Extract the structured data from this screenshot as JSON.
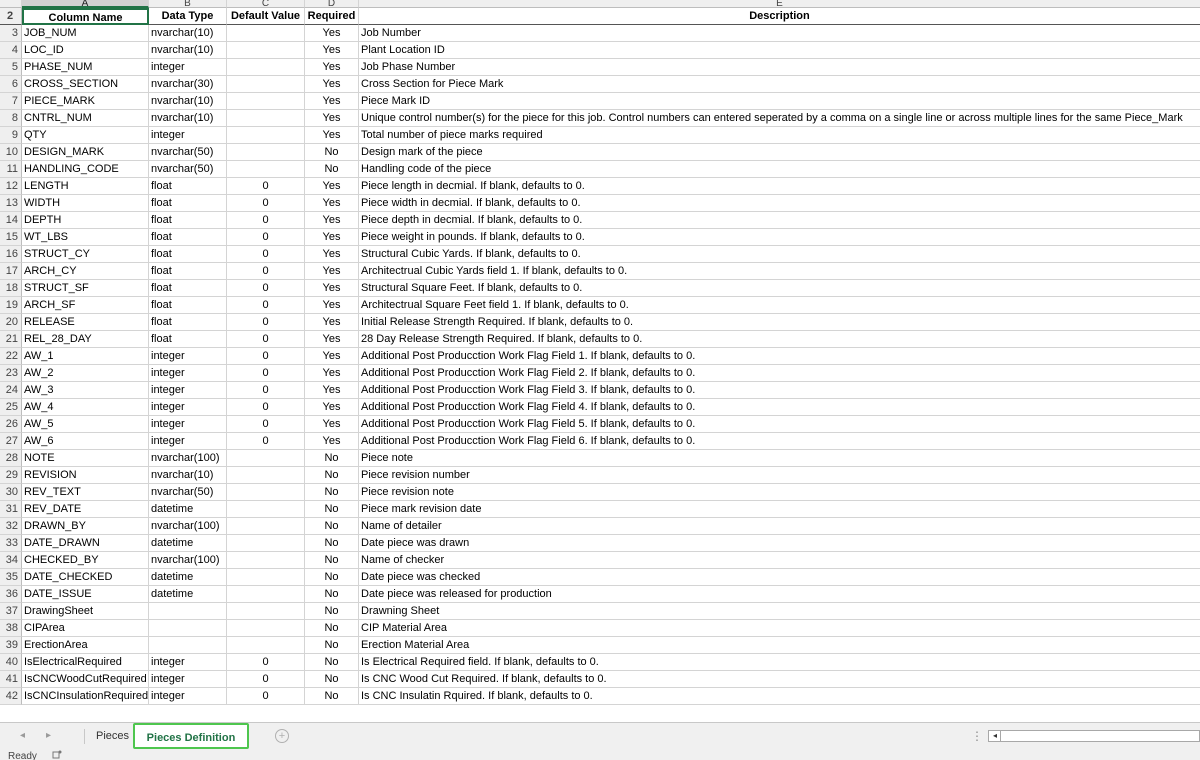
{
  "sheet": {
    "column_letters": [
      "A",
      "B",
      "C",
      "D",
      "E"
    ],
    "header_row": {
      "row_num": "2",
      "cells": [
        "Column Name",
        "Data Type",
        "Default Value",
        "Required",
        "Description"
      ]
    },
    "rows": [
      {
        "n": "3",
        "a": "JOB_NUM",
        "b": "nvarchar(10)",
        "c": "",
        "d": "Yes",
        "e": "Job Number"
      },
      {
        "n": "4",
        "a": "LOC_ID",
        "b": "nvarchar(10)",
        "c": "",
        "d": "Yes",
        "e": "Plant Location ID"
      },
      {
        "n": "5",
        "a": "PHASE_NUM",
        "b": "integer",
        "c": "",
        "d": "Yes",
        "e": "Job Phase Number"
      },
      {
        "n": "6",
        "a": "CROSS_SECTION",
        "b": "nvarchar(30)",
        "c": "",
        "d": "Yes",
        "e": "Cross Section for Piece Mark"
      },
      {
        "n": "7",
        "a": "PIECE_MARK",
        "b": "nvarchar(10)",
        "c": "",
        "d": "Yes",
        "e": "Piece Mark ID"
      },
      {
        "n": "8",
        "a": "CNTRL_NUM",
        "b": "nvarchar(10)",
        "c": "",
        "d": "Yes",
        "e": "Unique control number(s) for the piece for this job.  Control numbers can entered seperated by a comma on a single line or across multiple lines for the same Piece_Mark"
      },
      {
        "n": "9",
        "a": "QTY",
        "b": "integer",
        "c": "",
        "d": "Yes",
        "e": "Total number of piece marks required"
      },
      {
        "n": "10",
        "a": "DESIGN_MARK",
        "b": "nvarchar(50)",
        "c": "",
        "d": "No",
        "e": "Design mark of the piece"
      },
      {
        "n": "11",
        "a": "HANDLING_CODE",
        "b": "nvarchar(50)",
        "c": "",
        "d": "No",
        "e": "Handling code of the piece"
      },
      {
        "n": "12",
        "a": "LENGTH",
        "b": "float",
        "c": "0",
        "d": "Yes",
        "e": "Piece length in decmial. If blank, defaults to 0."
      },
      {
        "n": "13",
        "a": "WIDTH",
        "b": "float",
        "c": "0",
        "d": "Yes",
        "e": "Piece width in decmial. If blank, defaults to 0."
      },
      {
        "n": "14",
        "a": "DEPTH",
        "b": "float",
        "c": "0",
        "d": "Yes",
        "e": "Piece depth in decmial. If blank, defaults to 0."
      },
      {
        "n": "15",
        "a": "WT_LBS",
        "b": "float",
        "c": "0",
        "d": "Yes",
        "e": "Piece weight in pounds. If blank, defaults to 0."
      },
      {
        "n": "16",
        "a": "STRUCT_CY",
        "b": "float",
        "c": "0",
        "d": "Yes",
        "e": "Structural Cubic Yards. If blank, defaults to 0."
      },
      {
        "n": "17",
        "a": "ARCH_CY",
        "b": "float",
        "c": "0",
        "d": "Yes",
        "e": "Architectrual Cubic Yards field 1. If blank, defaults to 0."
      },
      {
        "n": "18",
        "a": "STRUCT_SF",
        "b": "float",
        "c": "0",
        "d": "Yes",
        "e": "Structural Square Feet. If blank, defaults to 0."
      },
      {
        "n": "19",
        "a": "ARCH_SF",
        "b": "float",
        "c": "0",
        "d": "Yes",
        "e": "Architectrual Square Feet field 1. If blank, defaults to 0."
      },
      {
        "n": "20",
        "a": "RELEASE",
        "b": "float",
        "c": "0",
        "d": "Yes",
        "e": "Initial Release Strength Required. If blank, defaults to 0."
      },
      {
        "n": "21",
        "a": "REL_28_DAY",
        "b": "float",
        "c": "0",
        "d": "Yes",
        "e": "28 Day Release Strength Required. If blank, defaults to 0."
      },
      {
        "n": "22",
        "a": "AW_1",
        "b": "integer",
        "c": "0",
        "d": "Yes",
        "e": "Additional Post Producction Work Flag Field 1. If blank, defaults to 0."
      },
      {
        "n": "23",
        "a": "AW_2",
        "b": "integer",
        "c": "0",
        "d": "Yes",
        "e": "Additional Post Producction Work Flag Field 2. If blank, defaults to 0."
      },
      {
        "n": "24",
        "a": "AW_3",
        "b": "integer",
        "c": "0",
        "d": "Yes",
        "e": "Additional Post Producction Work Flag Field 3. If blank, defaults to 0."
      },
      {
        "n": "25",
        "a": "AW_4",
        "b": "integer",
        "c": "0",
        "d": "Yes",
        "e": "Additional Post Producction Work Flag Field 4. If blank, defaults to 0."
      },
      {
        "n": "26",
        "a": "AW_5",
        "b": "integer",
        "c": "0",
        "d": "Yes",
        "e": "Additional Post Producction Work Flag Field 5. If blank, defaults to 0."
      },
      {
        "n": "27",
        "a": "AW_6",
        "b": "integer",
        "c": "0",
        "d": "Yes",
        "e": "Additional Post Producction Work Flag Field 6. If blank, defaults to 0."
      },
      {
        "n": "28",
        "a": "NOTE",
        "b": "nvarchar(100)",
        "c": "",
        "d": "No",
        "e": "Piece note"
      },
      {
        "n": "29",
        "a": "REVISION",
        "b": "nvarchar(10)",
        "c": "",
        "d": "No",
        "e": "Piece revision number"
      },
      {
        "n": "30",
        "a": "REV_TEXT",
        "b": "nvarchar(50)",
        "c": "",
        "d": "No",
        "e": "Piece revision note"
      },
      {
        "n": "31",
        "a": "REV_DATE",
        "b": "datetime",
        "c": "",
        "d": "No",
        "e": "Piece mark revision date"
      },
      {
        "n": "32",
        "a": "DRAWN_BY",
        "b": "nvarchar(100)",
        "c": "",
        "d": "No",
        "e": "Name of detailer"
      },
      {
        "n": "33",
        "a": "DATE_DRAWN",
        "b": "datetime",
        "c": "",
        "d": "No",
        "e": "Date piece was drawn"
      },
      {
        "n": "34",
        "a": "CHECKED_BY",
        "b": "nvarchar(100)",
        "c": "",
        "d": "No",
        "e": "Name of checker"
      },
      {
        "n": "35",
        "a": "DATE_CHECKED",
        "b": "datetime",
        "c": "",
        "d": "No",
        "e": "Date piece was checked"
      },
      {
        "n": "36",
        "a": "DATE_ISSUE",
        "b": "datetime",
        "c": "",
        "d": "No",
        "e": "Date piece was released for production"
      },
      {
        "n": "37",
        "a": "DrawingSheet",
        "b": "",
        "c": "",
        "d": "No",
        "e": "Drawning Sheet"
      },
      {
        "n": "38",
        "a": "CIPArea",
        "b": "",
        "c": "",
        "d": "No",
        "e": "CIP Material Area"
      },
      {
        "n": "39",
        "a": "ErectionArea",
        "b": "",
        "c": "",
        "d": "No",
        "e": "Erection Material Area"
      },
      {
        "n": "40",
        "a": "IsElectricalRequired",
        "b": "integer",
        "c": "0",
        "d": "No",
        "e": "Is Electrical Required field. If blank, defaults to 0."
      },
      {
        "n": "41",
        "a": "IsCNCWoodCutRequired",
        "b": "integer",
        "c": "0",
        "d": "No",
        "e": "Is CNC Wood Cut Required. If blank, defaults to 0."
      },
      {
        "n": "42",
        "a": "IsCNCInsulationRequired",
        "b": "integer",
        "c": "0",
        "d": "No",
        "e": "Is CNC Insulatin Rquired. If blank, defaults to 0."
      }
    ]
  },
  "tabs": {
    "nav_prev": "◂",
    "nav_next": "▸",
    "items": [
      {
        "label": "Pieces",
        "active": false
      },
      {
        "label": "Pieces Definition",
        "active": true
      }
    ],
    "add_sheet_symbol": "+",
    "options_dots": "⋮",
    "scroll_left_arrow": "◂"
  },
  "status": {
    "text": "Ready",
    "macro_icon": "macro-recorder-icon"
  },
  "colors": {
    "accent": "#217346",
    "active_tab_border": "#4ec64e"
  }
}
